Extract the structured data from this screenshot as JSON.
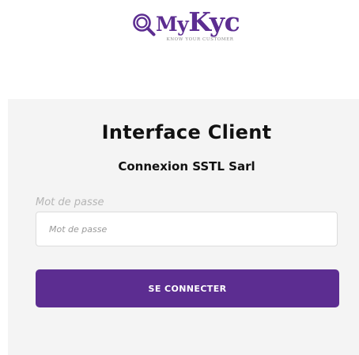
{
  "logo": {
    "icon": "magnifier-icon",
    "my": "My",
    "kyc": "Kyc",
    "tagline": "KNOW YOUR CUSTOMER"
  },
  "login": {
    "title": "Interface Client",
    "subtitle": "Connexion SSTL Sarl",
    "password_label": "Mot de passe",
    "password_placeholder": "Mot de passe",
    "password_value": "",
    "submit_label": "SE CONNECTER"
  },
  "colors": {
    "brand": "#5c2d91",
    "card_background": "#f4f4f4"
  }
}
